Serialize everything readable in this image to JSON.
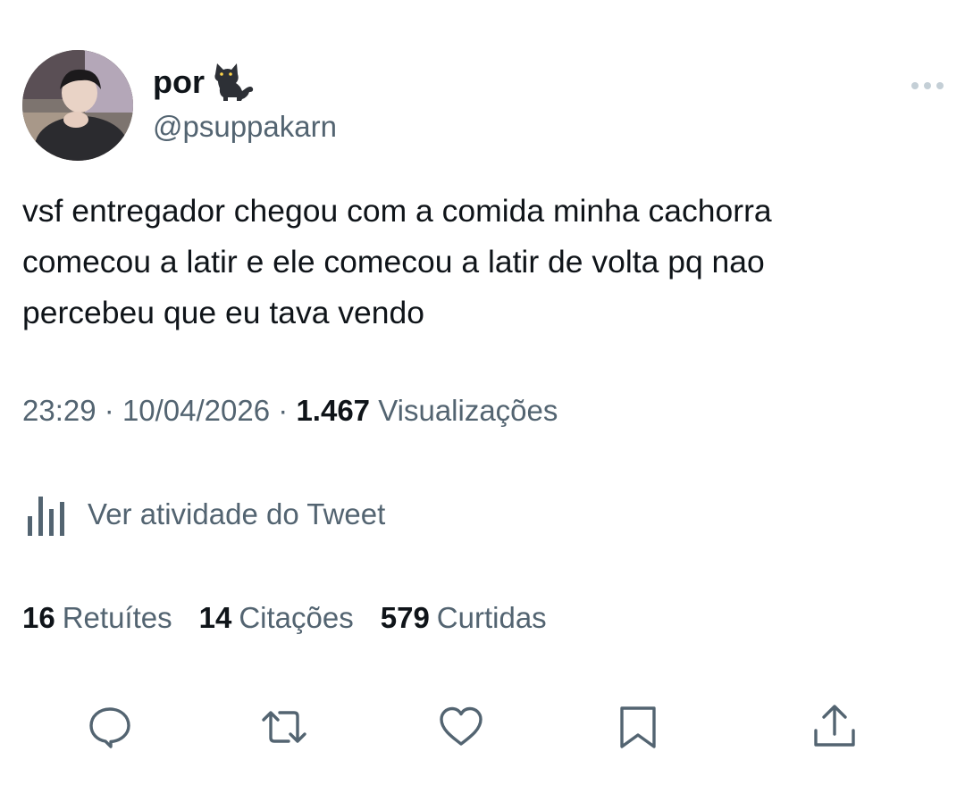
{
  "author": {
    "display_name": "por",
    "name_emoji": "cat-emoji",
    "handle": "@psuppakarn"
  },
  "tweet": {
    "text": "vsf entregador chegou com a comida minha cachorra\ncomecou a latir e ele comecou a latir de volta pq nao\npercebeu que eu tava vendo"
  },
  "meta": {
    "time": "23:29",
    "separator": "·",
    "date": "10/04/2026",
    "views_count": "1.467",
    "views_label": "Visualizações"
  },
  "activity": {
    "label": "Ver atividade do Tweet",
    "icon": "bar-chart-icon"
  },
  "stats": [
    {
      "count": "16",
      "label": "Retuítes"
    },
    {
      "count": "14",
      "label": "Citações"
    },
    {
      "count": "579",
      "label": "Curtidas"
    }
  ],
  "actions": [
    "reply-icon",
    "retweet-icon",
    "like-icon",
    "bookmark-icon",
    "share-icon"
  ],
  "colors": {
    "text_primary": "#0f1419",
    "text_secondary": "#536471",
    "icon": "#536471",
    "background": "#ffffff"
  }
}
